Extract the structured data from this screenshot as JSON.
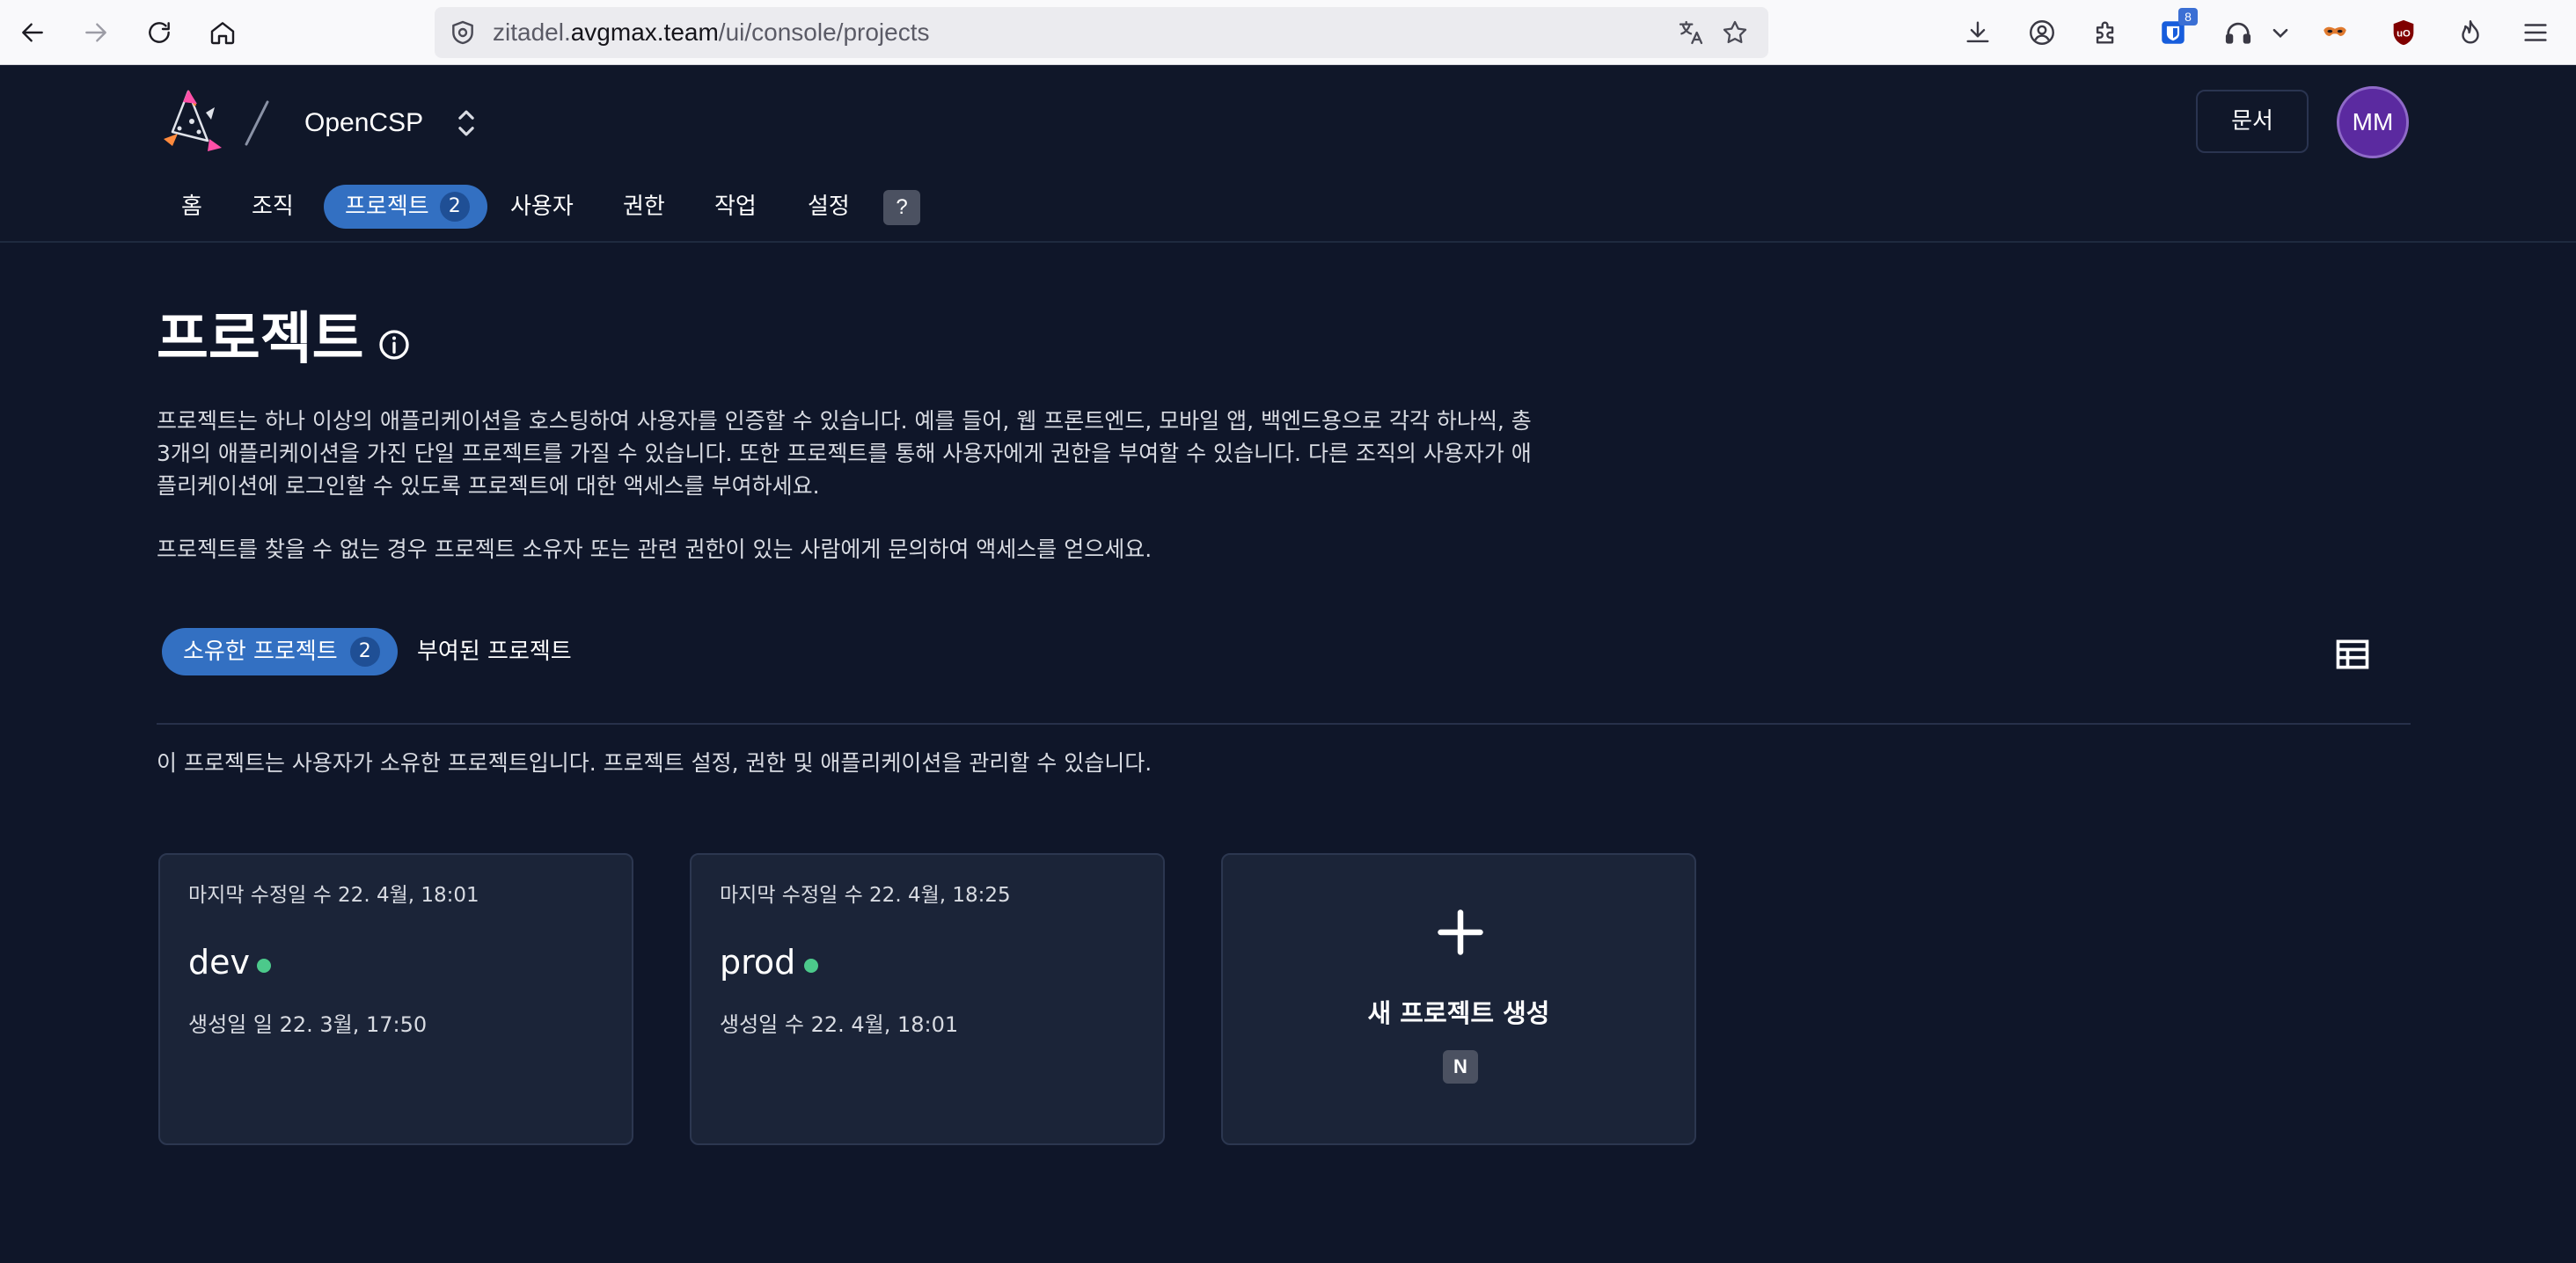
{
  "browser": {
    "url_prefix": "zitadel.",
    "url_domain": "avgmax.team",
    "url_path": "/ui/console/projects",
    "extension_badge": "8"
  },
  "header": {
    "org_name": "OpenCSP",
    "docs_label": "문서",
    "avatar_initials": "MM",
    "avatar_color": "#5b2aa0"
  },
  "nav": {
    "items": [
      {
        "label": "홈"
      },
      {
        "label": "조직"
      },
      {
        "label": "프로젝트",
        "count": "2"
      },
      {
        "label": "사용자"
      },
      {
        "label": "권한"
      },
      {
        "label": "작업"
      },
      {
        "label": "설정"
      }
    ],
    "help_label": "?",
    "accent_color": "#3370c2"
  },
  "page": {
    "title": "프로젝트",
    "description_lines": [
      "프로젝트는 하나 이상의 애플리케이션을 호스팅하여 사용자를 인증할 수 있습니다. 예를 들어, 웹 프론트엔드, 모바일 앱, 백엔드용으로 각각 하나씩, 총",
      "3개의 애플리케이션을 가진 단일 프로젝트를 가질 수 있습니다. 또한 프로젝트를 통해 사용자에게 권한을 부여할 수 있습니다. 다른 조직의 사용자가 애",
      "플리케이션에 로그인할 수 있도록 프로젝트에 대한 액세스를 부여하세요."
    ],
    "description2": "프로젝트를 찾을 수 없는 경우 프로젝트 소유자 또는 관련 권한이 있는 사람에게 문의하여 액세스를 얻으세요."
  },
  "tabs": {
    "owned_label": "소유한 프로젝트",
    "owned_count": "2",
    "granted_label": "부여된 프로젝트",
    "owned_description": "이 프로젝트는 사용자가 소유한 프로젝트입니다. 프로젝트 설정, 권한 및 애플리케이션을 관리할 수 있습니다."
  },
  "projects": [
    {
      "modified": "마지막 수정일 수 22. 4월, 18:01",
      "name": "dev",
      "created": "생성일 일 22. 3월, 17:50",
      "status_color": "#4cc98b"
    },
    {
      "modified": "마지막 수정일 수 22. 4월, 18:25",
      "name": "prod",
      "created": "생성일 수 22. 4월, 18:01",
      "status_color": "#4cc98b"
    }
  ],
  "new_project": {
    "label": "새 프로젝트 생성",
    "shortcut": "N"
  }
}
